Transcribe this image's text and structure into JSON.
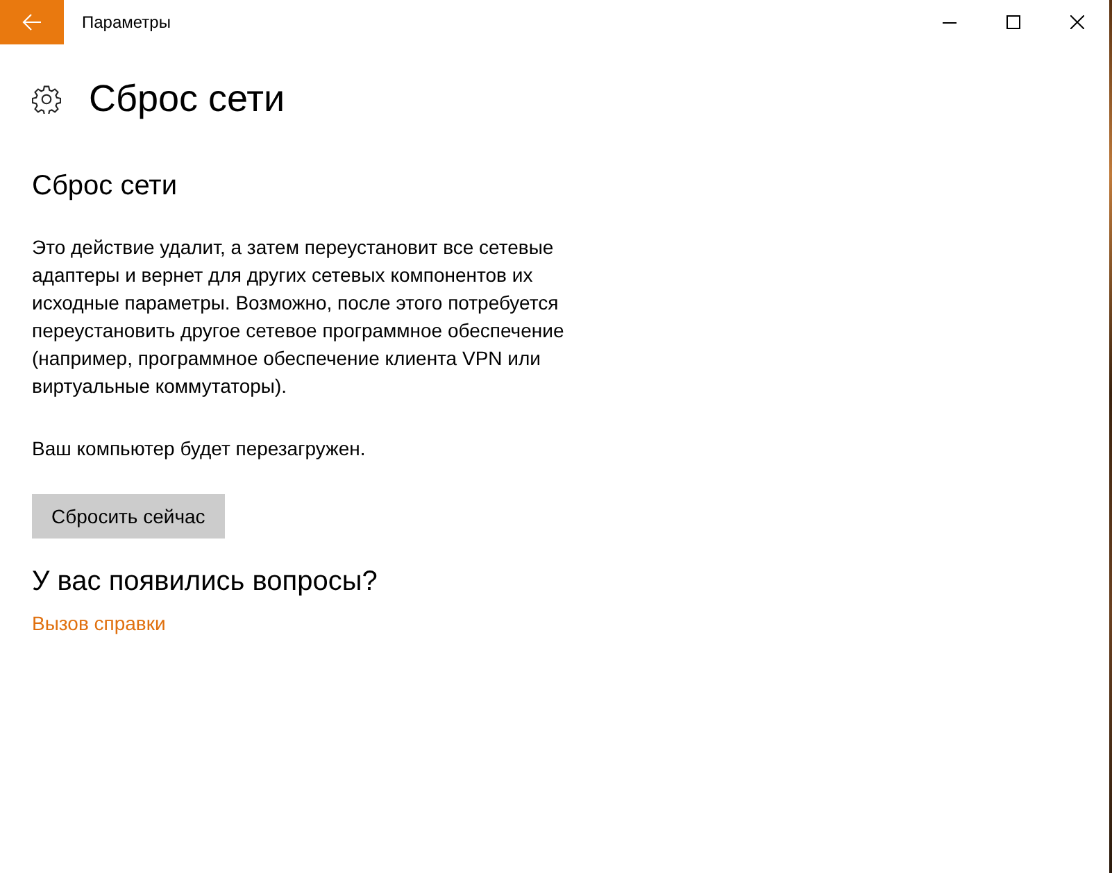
{
  "window": {
    "title": "Параметры"
  },
  "page": {
    "title": "Сброс сети"
  },
  "section": {
    "heading": "Сброс сети",
    "description": "Это действие удалит, а затем переустановит все сетевые адаптеры и вернет для других сетевых компонентов их исходные параметры. Возможно, после этого потребуется переустановить другое сетевое программное обеспечение (например, программное обеспечение клиента VPN или виртуальные коммутаторы).",
    "note": "Ваш компьютер будет перезагружен.",
    "button": "Сбросить сейчас"
  },
  "help": {
    "heading": "У вас появились вопросы?",
    "link": "Вызов справки"
  }
}
